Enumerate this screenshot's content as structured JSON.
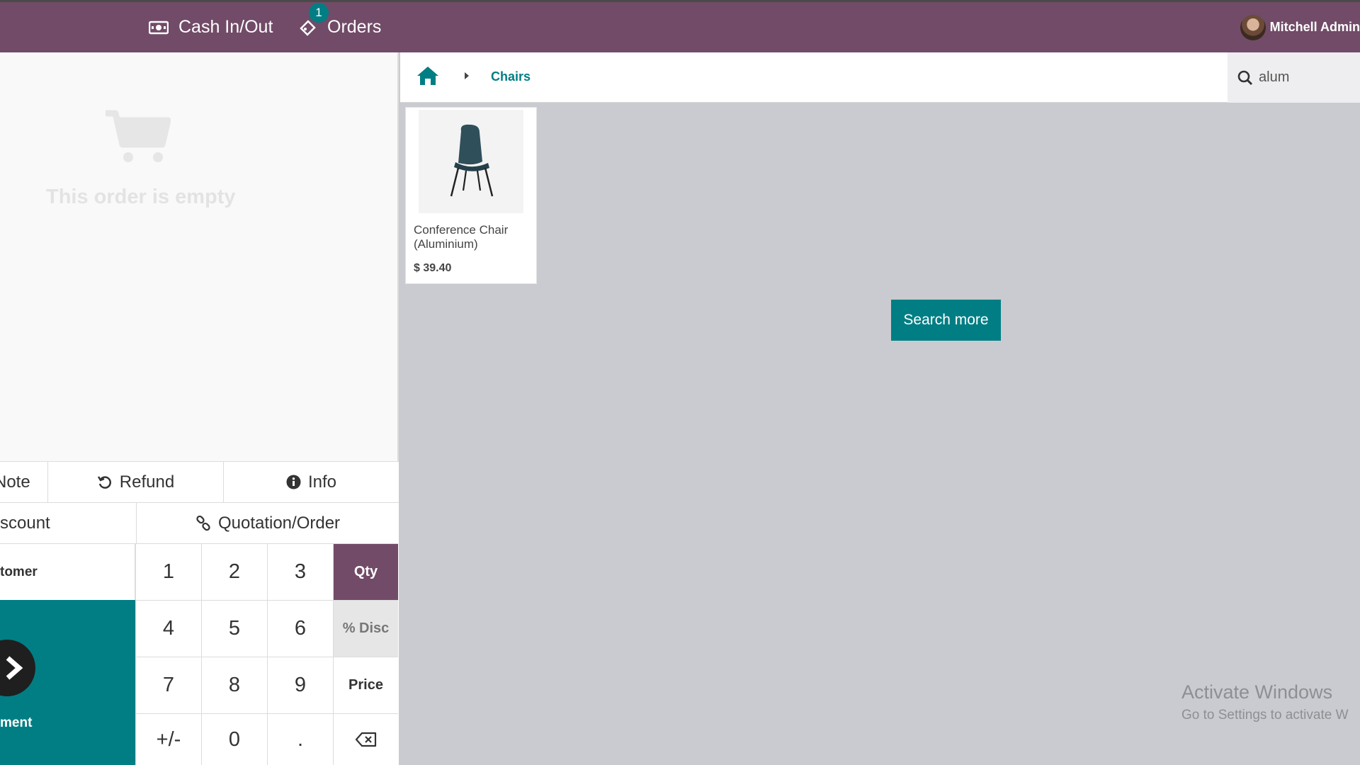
{
  "navbar": {
    "cash_label": "Cash In/Out",
    "orders_label": "Orders",
    "orders_badge": "1",
    "user_name": "Mitchell Admin"
  },
  "order": {
    "empty_text": "This order is empty"
  },
  "controls": {
    "note": "Note",
    "refund": "Refund",
    "info": "Info",
    "discount": "scount",
    "quotation": "Quotation/Order"
  },
  "keypad": {
    "customer": "tomer",
    "payment": "ment",
    "keys": [
      "1",
      "2",
      "3",
      "4",
      "5",
      "6",
      "7",
      "8",
      "9",
      "+/-",
      "0",
      "."
    ],
    "qty": "Qty",
    "disc": "% Disc",
    "price": "Price"
  },
  "breadcrumb": {
    "category": "Chairs"
  },
  "search": {
    "value": "alum"
  },
  "products": [
    {
      "name": "Conference Chair (Aluminium)",
      "price": "$ 39.40"
    }
  ],
  "search_more_label": "Search more",
  "watermark": {
    "line1": "Activate Windows",
    "line2": "Go to Settings to activate W"
  },
  "colors": {
    "brand": "#714b67",
    "accent": "#017e84"
  }
}
